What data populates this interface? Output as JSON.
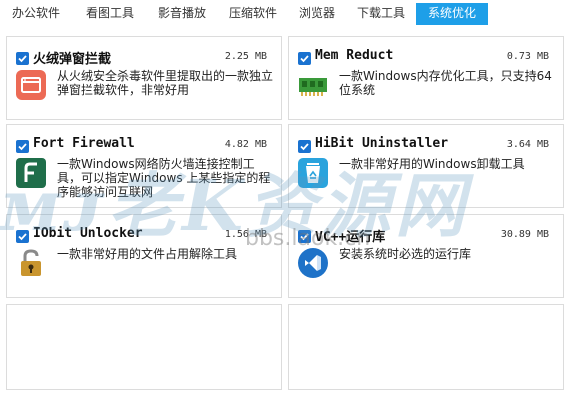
{
  "tabs": [
    {
      "label": "办公软件"
    },
    {
      "label": "看图工具"
    },
    {
      "label": "影音播放"
    },
    {
      "label": "压缩软件"
    },
    {
      "label": "浏览器"
    },
    {
      "label": "下载工具"
    },
    {
      "label": "系统优化",
      "active": true
    }
  ],
  "cards": [
    {
      "name": "火绒弹窗拦截",
      "size": "2.25 MB",
      "desc": "从火绒安全杀毒软件里提取出的一款独立弹窗拦截软件，非常好用",
      "checked": true,
      "icon": "huorong-popup-icon"
    },
    {
      "name": "Mem Reduct",
      "size": "0.73 MB",
      "desc": "一款Windows内存优化工具，只支持64位系统",
      "checked": true,
      "icon": "memory-chip-icon"
    },
    {
      "name": "Fort Firewall",
      "size": "4.82 MB",
      "desc": "一款Windows网络防火墙连接控制工具，可以指定Windows 上某些指定的程序能够访问互联网",
      "checked": true,
      "icon": "fort-firewall-icon"
    },
    {
      "name": "HiBit Uninstaller",
      "size": "3.64 MB",
      "desc": "一款非常好用的Windows卸载工具",
      "checked": true,
      "icon": "recycle-bin-icon"
    },
    {
      "name": "IObit Unlocker",
      "size": "1.56 MB",
      "desc": "一款非常好用的文件占用解除工具",
      "checked": true,
      "icon": "unlock-padlock-icon"
    },
    {
      "name": "VC++运行库",
      "size": "30.89 MB",
      "desc": "安装系统时必选的运行库",
      "checked": true,
      "icon": "visual-studio-icon"
    }
  ],
  "watermark": {
    "text": "ᴍᴊ老K资源网",
    "url": "bbs.laok.cn"
  },
  "colors": {
    "accent": "#1e9fe8",
    "checkbox": "#1a72d0",
    "border": "#dcdcdc"
  }
}
